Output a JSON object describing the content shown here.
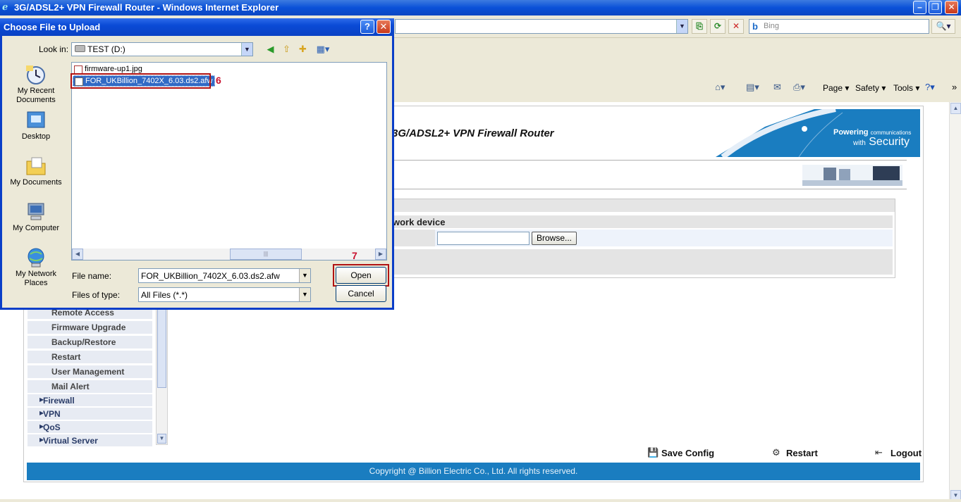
{
  "browser": {
    "window_title": "3G/ADSL2+ VPN Firewall Router - Windows Internet Explorer",
    "search_placeholder": "Bing",
    "command_bar": {
      "page": "Page ▾",
      "safety": "Safety ▾",
      "tools": "Tools ▾"
    }
  },
  "router_page": {
    "title": "3G/ADSL2+ VPN Firewall Router",
    "brand_line1": "Powering",
    "brand_line1b": "communications",
    "brand_line2": "with",
    "brand_line2b": "Security",
    "section_label": "work device",
    "browse_label": "Browse...",
    "nav_sub_items": [
      "Remote Access",
      "Firmware Upgrade",
      "Backup/Restore",
      "Restart",
      "User Management",
      "Mail Alert"
    ],
    "nav_main_items": [
      "Firewall",
      "VPN",
      "QoS",
      "Virtual Server"
    ],
    "actions": {
      "save_config": "Save Config",
      "restart": "Restart",
      "logout": "Logout"
    },
    "copyright": "Copyright @ Billion Electric Co., Ltd. All rights reserved."
  },
  "dialog": {
    "title": "Choose File to Upload",
    "look_in_label": "Look in:",
    "look_in_value": "TEST (D:)",
    "places": [
      "My Recent Documents",
      "Desktop",
      "My Documents",
      "My Computer",
      "My Network Places"
    ],
    "files": [
      "firmware-up1.jpg",
      "FOR_UKBillion_7402X_6.03.ds2.afw"
    ],
    "file_name_label": "File name:",
    "file_name_value": "FOR_UKBillion_7402X_6.03.ds2.afw",
    "file_type_label": "Files of type:",
    "file_type_value": "All Files (*.*)",
    "open_label": "Open",
    "cancel_label": "Cancel",
    "annotation_6": "6",
    "annotation_7": "7"
  },
  "colors": {
    "footer_blue": "#1a7dc0",
    "annotation_red": "#c8102e",
    "selection_blue": "#316ac5"
  }
}
